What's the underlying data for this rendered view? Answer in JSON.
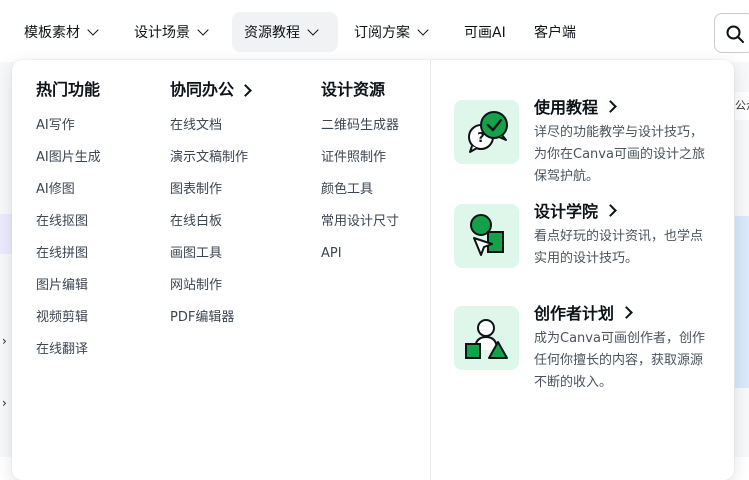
{
  "nav": {
    "items": [
      {
        "label": "模板素材",
        "has_chevron": true
      },
      {
        "label": "设计场景",
        "has_chevron": true
      },
      {
        "label": "资源教程",
        "has_chevron": true,
        "active": true
      },
      {
        "label": "订阅方案",
        "has_chevron": true
      },
      {
        "label": "可画AI",
        "has_chevron": false
      },
      {
        "label": "客户端",
        "has_chevron": false
      }
    ],
    "search_icon": "search-icon"
  },
  "background": {
    "partial_text": "公众"
  },
  "dropdown": {
    "columns": [
      {
        "title": "热门功能",
        "has_arrow": false,
        "items": [
          "AI写作",
          "AI图片生成",
          "AI修图",
          "在线抠图",
          "在线拼图",
          "图片编辑",
          "视频剪辑",
          "在线翻译"
        ]
      },
      {
        "title": "协同办公",
        "has_arrow": true,
        "items": [
          "在线文档",
          "演示文稿制作",
          "图表制作",
          "在线白板",
          "画图工具",
          "网站制作",
          "PDF编辑器"
        ]
      },
      {
        "title": "设计资源",
        "has_arrow": false,
        "items": [
          "二维码生成器",
          "证件照制作",
          "颜色工具",
          "常用设计尺寸",
          "API"
        ]
      }
    ],
    "cards": [
      {
        "title": "使用教程",
        "desc": "详尽的功能教学与设计技巧，为你在Canva可画的设计之旅保驾护航。",
        "icon": "chat-bubbles-icon"
      },
      {
        "title": "设计学院",
        "desc": "看点好玩的设计资讯，也学点实用的设计技巧。",
        "icon": "cursor-shapes-icon"
      },
      {
        "title": "创作者计划",
        "desc": "成为Canva可画创作者，创作任何你擅长的内容，获取源源不断的收入。",
        "icon": "person-shapes-icon"
      }
    ]
  },
  "colors": {
    "accent_green": "#15a04a",
    "icon_bg": "#dff7ea",
    "active_nav_bg": "#f1f2f4"
  }
}
